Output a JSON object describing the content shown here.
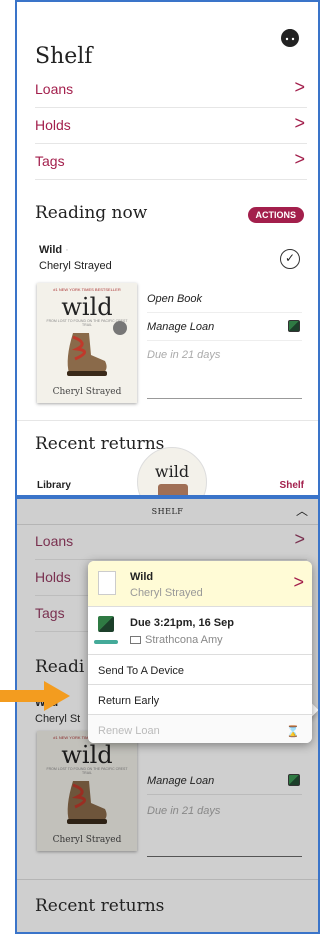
{
  "top": {
    "title": "Shelf",
    "nav": [
      {
        "label": "Loans",
        "chevron": ">"
      },
      {
        "label": "Holds",
        "chevron": ">"
      },
      {
        "label": "Tags",
        "chevron": ">"
      }
    ],
    "reading_now": {
      "heading": "Reading now",
      "actions_label": "ACTIONS",
      "book": {
        "title": "Wild",
        "dot": "·",
        "author": "Cheryl Strayed",
        "check": "✓"
      },
      "options": [
        {
          "label": "Open Book"
        },
        {
          "label": "Manage Loan"
        },
        {
          "label": "Due in 21 days"
        }
      ]
    },
    "recent_returns": {
      "heading": "Recent returns",
      "left_label": "Library",
      "right_label": "Shelf"
    }
  },
  "cover": {
    "tag": "#1 NEW YORK TIMES BESTSELLER",
    "title": "wild",
    "subtitle": "FROM LOST TO FOUND ON THE PACIFIC CREST TRAIL",
    "author": "Cheryl Strayed"
  },
  "bottom": {
    "header_title": "SHELF",
    "header_icon": "︿",
    "nav": [
      {
        "label": "Loans",
        "chevron": ">"
      },
      {
        "label": "Holds"
      },
      {
        "label": "Tags"
      }
    ],
    "reading_heading_partial": "Readi",
    "book_title_partial": "Wild",
    "book_author_partial": "Cheryl St",
    "manage_loan": "Manage Loan",
    "due": "Due in 21 days",
    "recent_returns": "Recent returns",
    "popover": {
      "title": "Wild",
      "author": "Cheryl Strayed",
      "chevron": ">",
      "due": "Due 3:21pm, 16 Sep",
      "library": "Strathcona Amy",
      "items": [
        "Send To A Device",
        "Return Early"
      ],
      "disabled_item": "Renew Loan",
      "disabled_icon": "⌛"
    }
  },
  "colors": {
    "accent": "#a31f4c",
    "frame": "#3a74c9",
    "arrow": "#f39c1f",
    "popover_header": "#fffbd6"
  }
}
